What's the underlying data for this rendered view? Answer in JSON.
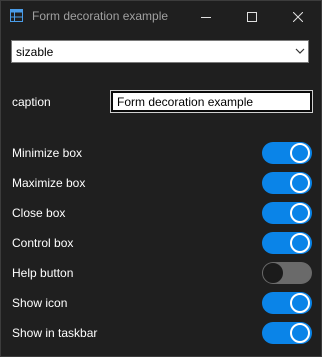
{
  "window": {
    "title": "Form decoration example",
    "icon": "window-app-icon",
    "caption_buttons": [
      "minimize-icon",
      "maximize-icon",
      "close-icon"
    ]
  },
  "combo": {
    "selected": "sizable",
    "arrow_icon": "chevron-down-icon"
  },
  "caption": {
    "label": "caption",
    "value": "Form decoration example"
  },
  "options": [
    {
      "label": "Minimize box",
      "on": true
    },
    {
      "label": "Maximize box",
      "on": true
    },
    {
      "label": "Close box",
      "on": true
    },
    {
      "label": "Control box",
      "on": true
    },
    {
      "label": "Help button",
      "on": false
    },
    {
      "label": "Show icon",
      "on": true
    },
    {
      "label": "Show in taskbar",
      "on": true
    }
  ],
  "colors": {
    "background": "#1f1f1f",
    "toggle_on": "#0a84e8",
    "toggle_off": "#6a6a6a"
  }
}
